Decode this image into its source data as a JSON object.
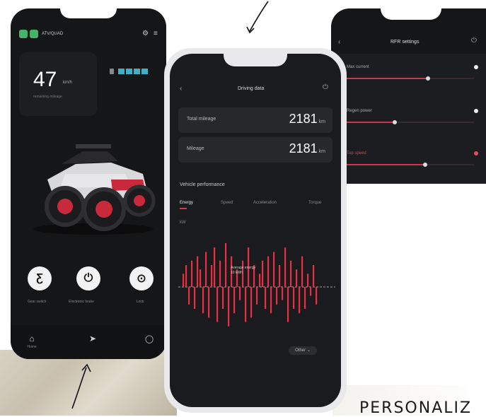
{
  "left_phone": {
    "header_title": "ATV/QUAD",
    "speed_value": "47",
    "speed_unit": "km/h",
    "speed_caption": "remaining mileage",
    "buttons": [
      {
        "label": "Gear switch",
        "icon": "gear-switch-icon",
        "glyph": "Ƹ"
      },
      {
        "label": "Electronic brake",
        "icon": "power-icon",
        "glyph": "⏻"
      },
      {
        "label": "Lock",
        "icon": "steering-icon",
        "glyph": "⊙"
      }
    ],
    "nav": [
      {
        "label": "Home",
        "icon": "home-icon"
      },
      {
        "label": "",
        "icon": "navigation-icon"
      },
      {
        "label": "",
        "icon": "chat-icon"
      }
    ],
    "battery_segments": 4
  },
  "middle_phone": {
    "title": "Driving data",
    "rows": [
      {
        "label": "Total mileage",
        "value": "2181",
        "unit": "km"
      },
      {
        "label": "Mileage",
        "value": "2181",
        "unit": "km"
      }
    ],
    "section_title": "Vehicle performance",
    "tabs": [
      "Energy",
      "Speed",
      "Acceleration",
      "Torque"
    ],
    "active_tab": "Energy",
    "y_unit": "kW",
    "annotation_line1": "Average energy",
    "annotation_line2": "10 kWh",
    "filter_button": "Other",
    "chart_data": {
      "type": "bar",
      "series": [
        {
          "values": [
            3,
            5,
            -4,
            6,
            -5,
            7,
            4,
            -6,
            8,
            -7,
            5,
            9,
            -8,
            6,
            -5,
            10,
            -9,
            7,
            -6,
            4,
            -3,
            6,
            -8,
            9,
            -7,
            5,
            -4,
            3,
            6,
            -5,
            7,
            -6,
            8,
            -4,
            5,
            -3,
            9,
            -8,
            6,
            -5,
            4,
            -6,
            7,
            -5,
            3,
            -2,
            5,
            -4
          ]
        }
      ]
    }
  },
  "right_phone": {
    "title": "RFR settings",
    "items": [
      {
        "label": "Max current",
        "level": 0.62
      },
      {
        "label": "Regen power",
        "level": 0.36
      },
      {
        "label": "Top speed",
        "level": 0.6
      }
    ]
  },
  "headline": "PERSONALIZ",
  "colors": {
    "accent": "#e03344",
    "bg_dark": "#151618",
    "teal": "#3fb0c7",
    "green": "#46b36a"
  }
}
